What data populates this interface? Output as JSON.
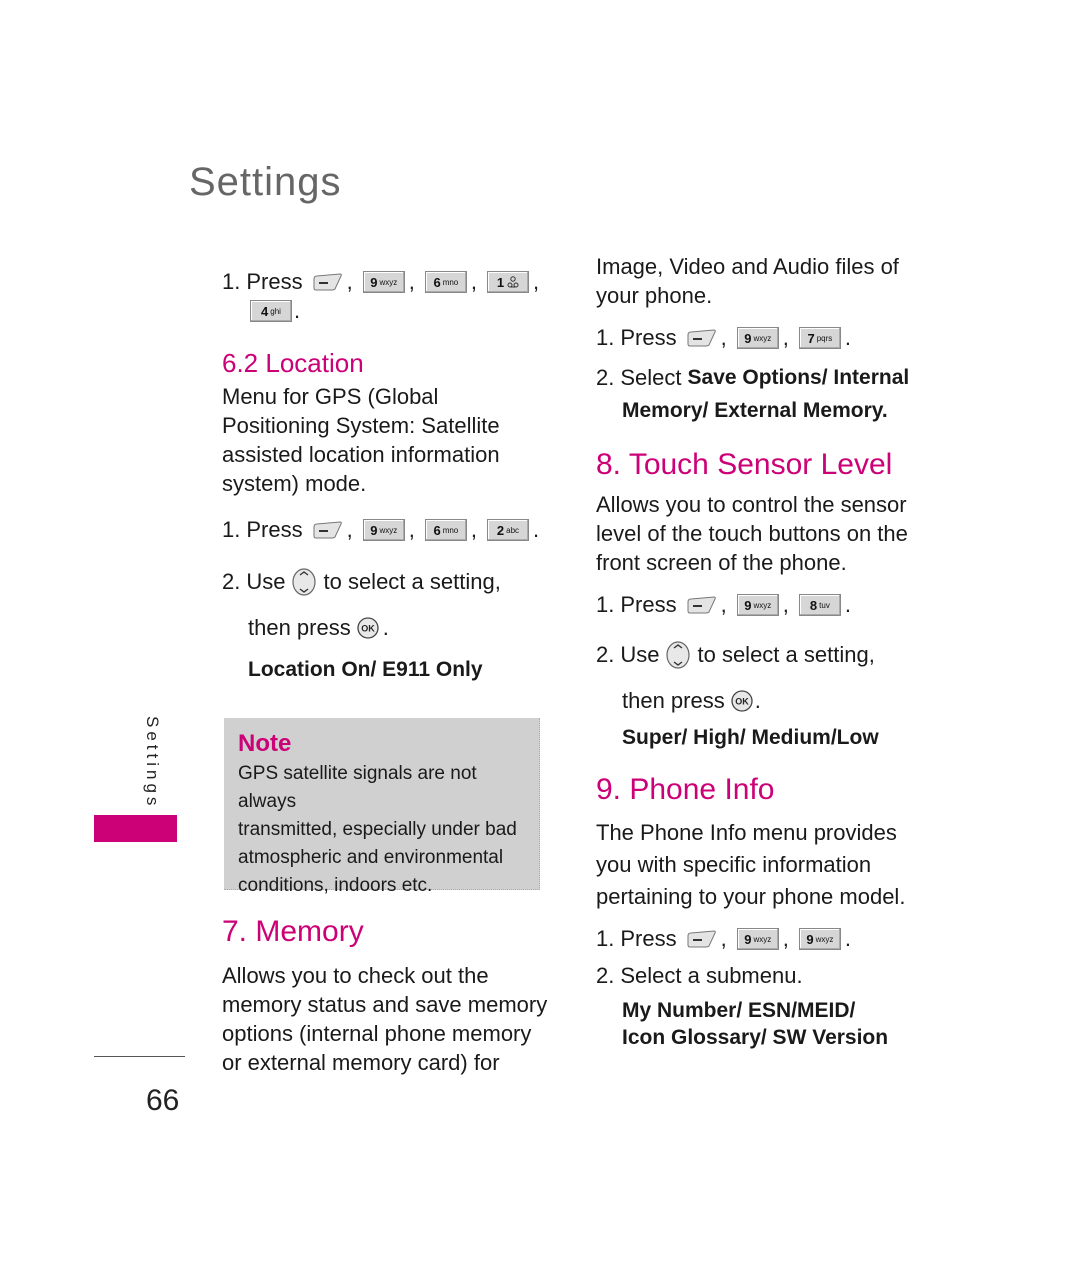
{
  "page": {
    "title": "Settings",
    "side_label": "Settings",
    "page_number": "66",
    "accent_color": "#cc0077"
  },
  "left": {
    "intro_step": {
      "num": "1.",
      "verb": "Press",
      "keys": [
        {
          "type": "softkey",
          "icon": "left-softkey-icon"
        },
        {
          "type": "key",
          "digit": "9",
          "letters": "wxyz"
        },
        {
          "type": "key",
          "digit": "6",
          "letters": "mno"
        },
        {
          "type": "key",
          "digit": "1",
          "letters": "voicemail"
        },
        {
          "type": "key",
          "digit": "4",
          "letters": "ghi"
        }
      ],
      "end": "."
    },
    "location": {
      "heading": "6.2 Location",
      "desc_lines": [
        "Menu for GPS (Global",
        "Positioning System: Satellite",
        "assisted location information",
        "system) mode."
      ],
      "step1": {
        "num": "1.",
        "verb": "Press",
        "keys": [
          {
            "digit": "9",
            "letters": "wxyz"
          },
          {
            "digit": "6",
            "letters": "mno"
          },
          {
            "digit": "2",
            "letters": "abc"
          }
        ],
        "end": "."
      },
      "step2": {
        "num": "2.",
        "pre": "Use",
        "post": "to select a setting,",
        "line2": "then press",
        "end": "."
      },
      "options": "Location On/ E911  Only"
    },
    "note": {
      "title": "Note",
      "lines": [
        "GPS satellite signals are not always",
        "transmitted, especially under bad",
        "atmospheric and environmental",
        "conditions, indoors etc."
      ]
    },
    "memory": {
      "heading": "7. Memory",
      "desc_lines": [
        "Allows you to check out the",
        "memory status and save memory",
        "options (internal phone memory",
        "or external memory card) for"
      ]
    }
  },
  "right": {
    "memory_cont": {
      "desc_lines": [
        "Image, Video and Audio files of",
        "your phone."
      ],
      "step1": {
        "num": "1.",
        "verb": "Press",
        "keys": [
          {
            "digit": "9",
            "letters": "wxyz"
          },
          {
            "digit": "7",
            "letters": "pqrs"
          }
        ],
        "end": "."
      },
      "step2": {
        "num": "2.",
        "pre": "Select",
        "bold_line1": "Save Options/ Internal",
        "bold_line2": "Memory/ External Memory."
      }
    },
    "touch": {
      "heading": "8. Touch Sensor Level",
      "desc_lines": [
        "Allows you to control the sensor",
        "level of the touch buttons on the",
        "front screen of the phone."
      ],
      "step1": {
        "num": "1.",
        "verb": "Press",
        "keys": [
          {
            "digit": "9",
            "letters": "wxyz"
          },
          {
            "digit": "8",
            "letters": "tuv"
          }
        ],
        "end": "."
      },
      "step2": {
        "num": "2.",
        "pre": "Use",
        "post": "to select a setting,",
        "line2": "then press",
        "end": "."
      },
      "options": "Super/ High/ Medium/Low"
    },
    "phone_info": {
      "heading": "9. Phone Info",
      "desc_lines": [
        "The Phone Info menu provides",
        "you with specific information",
        "pertaining to your phone model."
      ],
      "step1": {
        "num": "1.",
        "verb": "Press",
        "keys": [
          {
            "digit": "9",
            "letters": "wxyz"
          },
          {
            "digit": "9",
            "letters": "wxyz"
          }
        ],
        "end": "."
      },
      "step2": {
        "num": "2.",
        "text": "Select a submenu."
      },
      "options_line1": "My Number/ ESN/MEID/",
      "options_line2": "Icon Glossary/ SW Version"
    }
  }
}
